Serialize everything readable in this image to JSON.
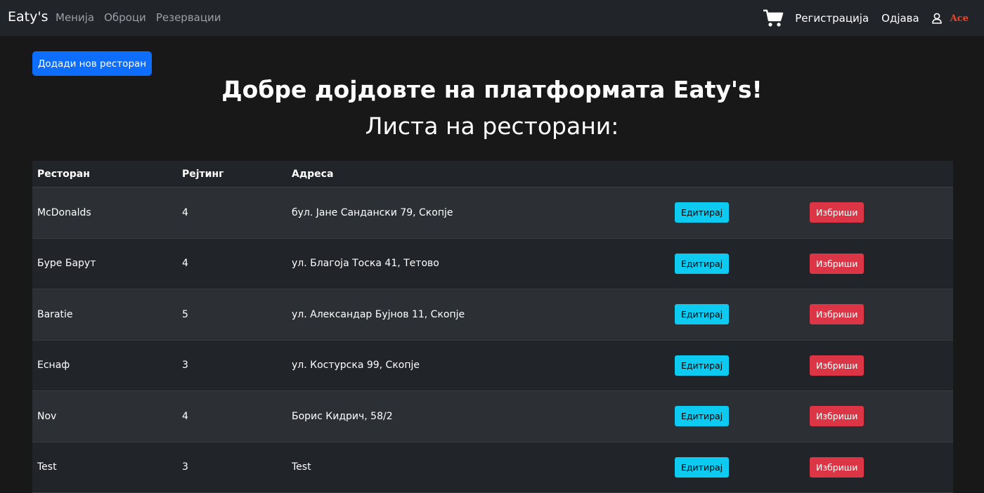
{
  "navbar": {
    "brand": "Eaty's",
    "links": [
      "Менија",
      "Оброци",
      "Резервации"
    ],
    "register": "Регистрација",
    "logout": "Одјава",
    "username": "Ace",
    "icons": {
      "cart": "cart-icon",
      "user": "user-icon"
    }
  },
  "main": {
    "add_button": "Додади нов ресторан",
    "welcome": "Добре дојдовте на платформата Eaty's!",
    "subtitle": "Листа на ресторани:"
  },
  "table": {
    "headers": [
      "Ресторан",
      "Рејтинг",
      "Адреса"
    ],
    "edit_label": "Едитирај",
    "delete_label": "Избриши",
    "rows": [
      {
        "name": "McDonalds",
        "rating": "4",
        "address": "бул. Јане Сандански 79, Скопје"
      },
      {
        "name": "Буре Барут",
        "rating": "4",
        "address": "ул. Благоја Тоска 41, Тетово"
      },
      {
        "name": "Baratie",
        "rating": "5",
        "address": "ул. Александар Бујнов 11, Скопје"
      },
      {
        "name": "Еснаф",
        "rating": "3",
        "address": "ул. Костурска 99, Скопје"
      },
      {
        "name": "Nov",
        "rating": "4",
        "address": "Борис Кидрич, 58/2"
      },
      {
        "name": "Test",
        "rating": "3",
        "address": "Test"
      }
    ]
  },
  "colors": {
    "background": "#181818",
    "navbar": "#212529",
    "primary": "#0d6efd",
    "info": "#0dcaf0",
    "danger": "#dc3545",
    "username": "#e8462e"
  }
}
